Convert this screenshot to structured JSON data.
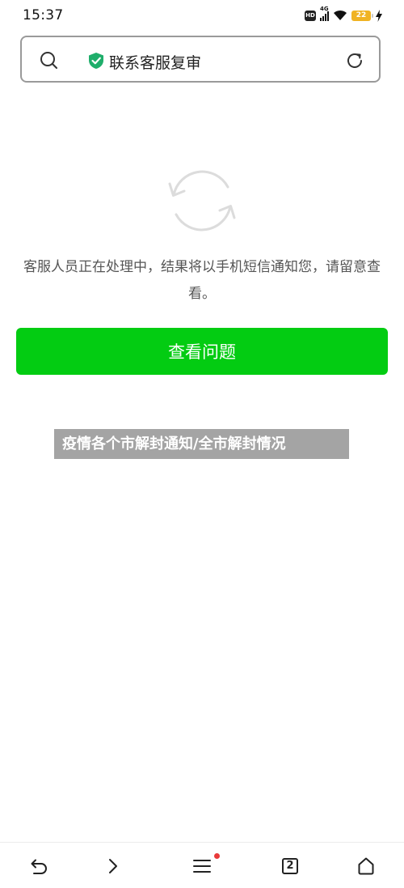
{
  "status_bar": {
    "time": "15:37",
    "hd_label": "HD",
    "network_label": "4G",
    "battery_level": "22",
    "icons": [
      "hd-icon",
      "signal-icon",
      "wifi-icon",
      "battery-icon",
      "charging-icon"
    ]
  },
  "address_bar": {
    "title": "联系客服复审",
    "icons": [
      "search-icon",
      "shield-check-icon",
      "refresh-icon"
    ],
    "shield_color": "#1fae6b"
  },
  "main": {
    "status_icon": "sync-icon",
    "message": "客服人员正在处理中，结果将以手机短信通知您，请留意查看。",
    "button_label": "查看问题",
    "button_color": "#03cc12"
  },
  "overlay": {
    "caption": "疫情各个市解封通知/全市解封情况"
  },
  "toolbar": {
    "tab_count": "2",
    "items": [
      "back-icon",
      "forward-icon",
      "menu-icon",
      "tabs-icon",
      "home-icon"
    ],
    "notification_dot_color": "#e93a3a"
  }
}
